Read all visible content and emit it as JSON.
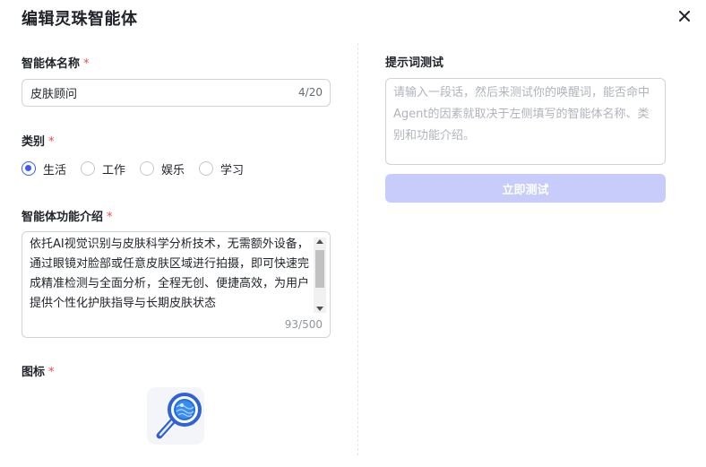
{
  "dialog": {
    "title": "编辑灵珠智能体"
  },
  "form": {
    "name": {
      "label": "智能体名称",
      "required_mark": "*",
      "value": "皮肤顾问",
      "count": "4/20"
    },
    "category": {
      "label": "类别",
      "required_mark": "*",
      "options": [
        {
          "label": "生活",
          "selected": true
        },
        {
          "label": "工作",
          "selected": false
        },
        {
          "label": "娱乐",
          "selected": false
        },
        {
          "label": "学习",
          "selected": false
        }
      ]
    },
    "description": {
      "label": "智能体功能介绍",
      "required_mark": "*",
      "value": "依托AI视觉识别与皮肤科学分析技术，无需额外设备，通过眼镜对脸部或任意皮肤区域进行拍摄，即可快速完成精准检测与全面分析，全程无创、便捷高效，为用户提供个性化护肤指导与长期皮肤状态",
      "count": "93/500"
    },
    "icon": {
      "label": "图标",
      "required_mark": "*",
      "name": "magnifier-globe-icon"
    }
  },
  "prompt_test": {
    "label": "提示词测试",
    "placeholder": "请输入一段话，然后来测试你的唤醒词，能否命中Agent的因素就取决于左侧填写的智能体名称、类别和功能介绍。",
    "button_label": "立即测试"
  },
  "colors": {
    "accent": "#3b5cf0",
    "required": "#f54a45",
    "button_disabled": "#c7ccfb",
    "border": "#d0d3d9"
  }
}
